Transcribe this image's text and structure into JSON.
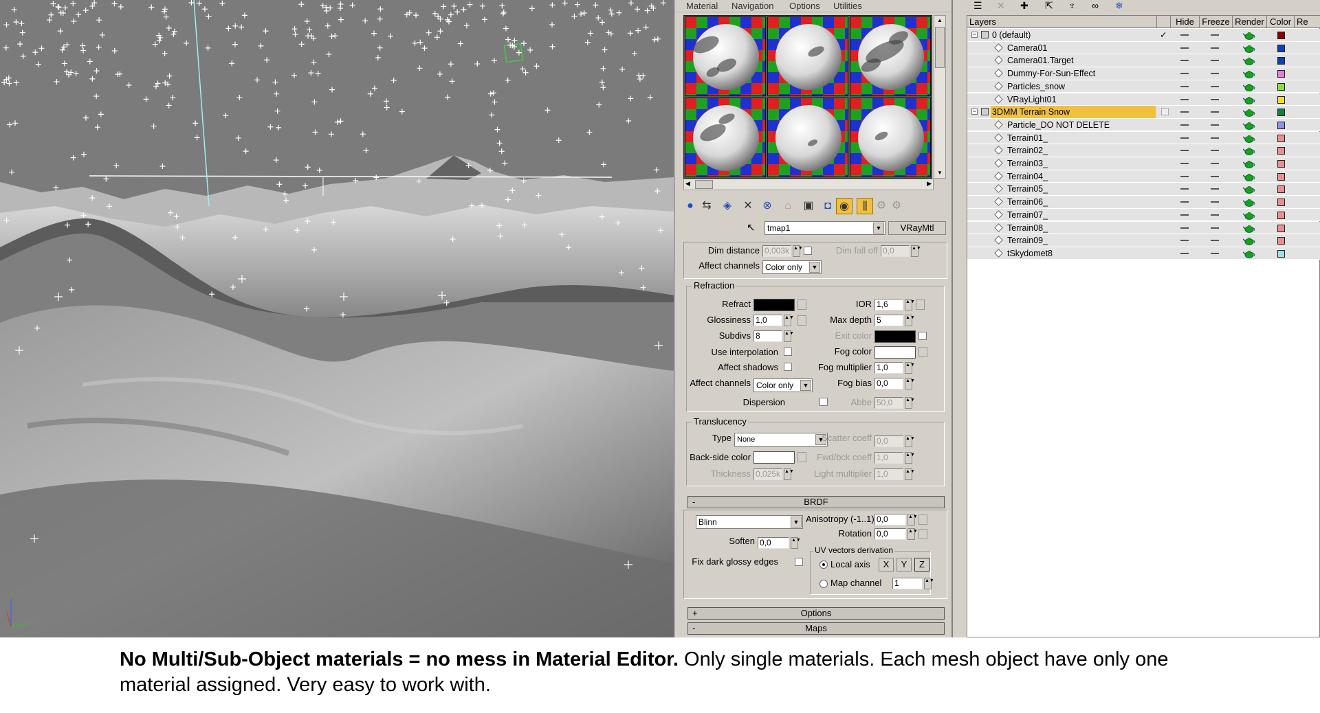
{
  "material_editor": {
    "menu": [
      "Material",
      "Navigation",
      "Options",
      "Utilities"
    ],
    "map_name": "tmap1",
    "type_button": "VRayMtl",
    "top": {
      "dim_distance_label": "Dim distance",
      "dim_distance_value": "0,003k",
      "dim_falloff_label": "Dim fall off",
      "dim_falloff_value": "0,0",
      "affect_channels_label": "Affect channels",
      "affect_channels_value": "Color only"
    },
    "refraction": {
      "title": "Refraction",
      "refract_label": "Refract",
      "refract_color": "#000000",
      "ior_label": "IOR",
      "ior_value": "1,6",
      "glossiness_label": "Glossiness",
      "glossiness_value": "1,0",
      "max_depth_label": "Max depth",
      "max_depth_value": "5",
      "subdivs_label": "Subdivs",
      "subdivs_value": "8",
      "exit_color_label": "Exit color",
      "exit_color": "#000000",
      "use_interpolation_label": "Use interpolation",
      "fog_color_label": "Fog color",
      "fog_color": "#ffffff",
      "affect_shadows_label": "Affect shadows",
      "fog_multiplier_label": "Fog multiplier",
      "fog_multiplier_value": "1,0",
      "affect_channels_label": "Affect channels",
      "affect_channels_value": "Color only",
      "fog_bias_label": "Fog bias",
      "fog_bias_value": "0,0",
      "dispersion_label": "Dispersion",
      "abbe_label": "Abbe",
      "abbe_value": "50,0"
    },
    "translucency": {
      "title": "Translucency",
      "type_label": "Type",
      "type_value": "None",
      "scatter_coeff_label": "Scatter coeff",
      "scatter_coeff_value": "0,0",
      "back_side_color_label": "Back-side color",
      "back_side_color": "#ffffff",
      "fwd_bck_coeff_label": "Fwd/bck coeff",
      "fwd_bck_coeff_value": "1,0",
      "thickness_label": "Thickness",
      "thickness_value": "0,025k",
      "light_multiplier_label": "Light multiplier",
      "light_multiplier_value": "1,0"
    },
    "brdf": {
      "title": "BRDF",
      "sign": "-",
      "type_value": "Blinn",
      "anisotropy_label": "Anisotropy (-1..1)",
      "anisotropy_value": "0,0",
      "rotation_label": "Rotation",
      "rotation_value": "0,0",
      "soften_label": "Soften",
      "soften_value": "0,0",
      "uv_group_title": "UV vectors derivation",
      "fix_dark_label": "Fix dark glossy edges",
      "local_axis_label": "Local axis",
      "axis_x": "X",
      "axis_y": "Y",
      "axis_z": "Z",
      "map_channel_label": "Map channel",
      "map_channel_value": "1"
    },
    "options_rollout": {
      "sign": "+",
      "title": "Options"
    },
    "maps_rollout": {
      "sign": "-",
      "title": "Maps"
    }
  },
  "layers": {
    "columns": {
      "layers": "Layers",
      "hide": "Hide",
      "freeze": "Freeze",
      "render": "Render",
      "color": "Color",
      "radiosity": "Re"
    },
    "rows": [
      {
        "name": "0 (default)",
        "layer": true,
        "tree": "−",
        "check": "✓",
        "color": "#8a0000"
      },
      {
        "name": "Camera01",
        "color": "#1040b0"
      },
      {
        "name": "Camera01.Target",
        "color": "#1040b0"
      },
      {
        "name": "Dummy-For-Sun-Effect",
        "color": "#e080d8"
      },
      {
        "name": "Particles_snow",
        "color": "#88dd44"
      },
      {
        "name": "VRayLight01",
        "color": "#f0e020"
      },
      {
        "name": "3DMM Terrain Snow",
        "layer": true,
        "tree": "−",
        "selected": true,
        "color": "#108040"
      },
      {
        "name": "Particle_DO NOT DELETE",
        "color": "#9090e8"
      },
      {
        "name": "Terrain01_",
        "color": "#e89090"
      },
      {
        "name": "Terrain02_",
        "color": "#e89090"
      },
      {
        "name": "Terrain03_",
        "color": "#e89090"
      },
      {
        "name": "Terrain04_",
        "color": "#e89090"
      },
      {
        "name": "Terrain05_",
        "color": "#e89090"
      },
      {
        "name": "Terrain06_",
        "color": "#e89090"
      },
      {
        "name": "Terrain07_",
        "color": "#e89090"
      },
      {
        "name": "Terrain08_",
        "color": "#e89090"
      },
      {
        "name": "Terrain09_",
        "color": "#e89090"
      },
      {
        "name": "tSkydomet8",
        "color": "#a0e0e8"
      }
    ]
  },
  "caption": {
    "bold": "No Multi/Sub-Object materials = no mess in Material Editor.",
    "normal": " Only single materials. Each mesh object have only one material assigned. Very easy to work with."
  },
  "colors": {
    "ui_gray": "#d4d0c8",
    "highlight": "#f0c040",
    "viewport_sky": "#7b7b7b"
  }
}
